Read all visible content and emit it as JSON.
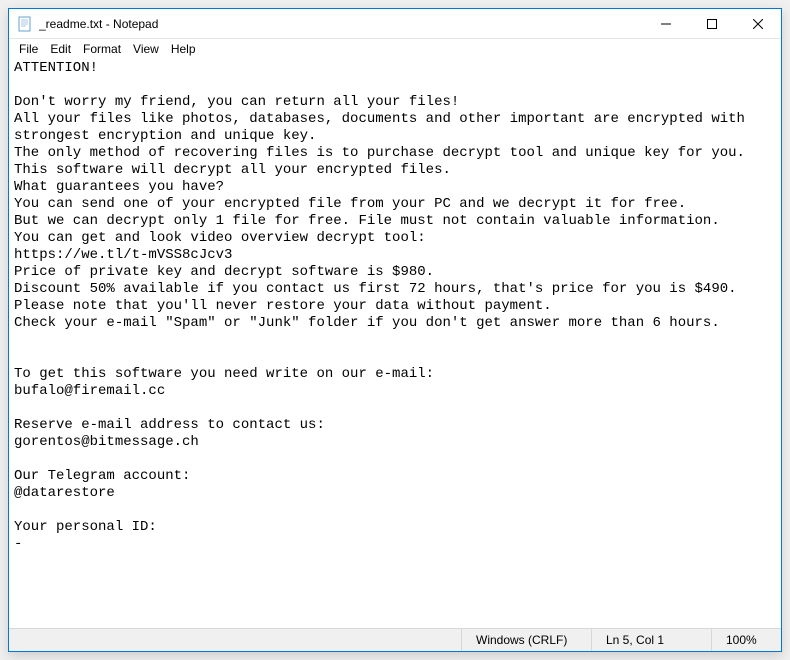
{
  "window": {
    "title": "_readme.txt - Notepad"
  },
  "menu": {
    "file": "File",
    "edit": "Edit",
    "format": "Format",
    "view": "View",
    "help": "Help"
  },
  "document": {
    "text": "ATTENTION!\n\nDon't worry my friend, you can return all your files!\nAll your files like photos, databases, documents and other important are encrypted with strongest encryption and unique key.\nThe only method of recovering files is to purchase decrypt tool and unique key for you.\nThis software will decrypt all your encrypted files.\nWhat guarantees you have?\nYou can send one of your encrypted file from your PC and we decrypt it for free.\nBut we can decrypt only 1 file for free. File must not contain valuable information.\nYou can get and look video overview decrypt tool:\nhttps://we.tl/t-mVSS8cJcv3\nPrice of private key and decrypt software is $980.\nDiscount 50% available if you contact us first 72 hours, that's price for you is $490.\nPlease note that you'll never restore your data without payment.\nCheck your e-mail \"Spam\" or \"Junk\" folder if you don't get answer more than 6 hours.\n\n\nTo get this software you need write on our e-mail:\nbufalo@firemail.cc\n\nReserve e-mail address to contact us:\ngorentos@bitmessage.ch\n\nOur Telegram account:\n@datarestore\n\nYour personal ID:\n-"
  },
  "status": {
    "line_ending": "Windows (CRLF)",
    "cursor": "Ln 5, Col 1",
    "zoom": "100%"
  }
}
